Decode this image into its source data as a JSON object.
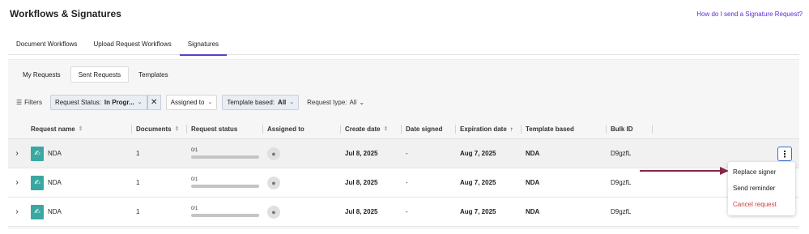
{
  "header": {
    "title": "Workflows & Signatures",
    "help_link": "How do I send a Signature Request?"
  },
  "main_tabs": [
    {
      "label": "Document Workflows"
    },
    {
      "label": "Upload Request Workflows"
    },
    {
      "label": "Signatures",
      "active": true
    }
  ],
  "sub_tabs": [
    {
      "label": "My Requests"
    },
    {
      "label": "Sent Requests",
      "active": true
    },
    {
      "label": "Templates"
    }
  ],
  "filters": {
    "label": "Filters",
    "request_status": {
      "name": "Request Status:",
      "value": "In Progr..."
    },
    "assigned_to": {
      "name": "Assigned to"
    },
    "template_based": {
      "name": "Template based:",
      "value": "All"
    },
    "request_type": {
      "name": "Request type:",
      "value": "All"
    }
  },
  "table": {
    "columns": [
      "Request name",
      "Documents",
      "Request status",
      "Assigned to",
      "Create date",
      "Date signed",
      "Expiration date",
      "Template based",
      "Bulk ID"
    ],
    "rows": [
      {
        "name": "NDA",
        "documents": "1",
        "status": "0/1",
        "progress": 0,
        "create_date": "Jul 8, 2025",
        "date_signed": "-",
        "expiration_date": "Aug 7, 2025",
        "template_based": "NDA",
        "bulk_id": "D9gzfL"
      },
      {
        "name": "NDA",
        "documents": "1",
        "status": "0/1",
        "progress": 0,
        "create_date": "Jul 8, 2025",
        "date_signed": "-",
        "expiration_date": "Aug 7, 2025",
        "template_based": "NDA",
        "bulk_id": "D9gzfL"
      },
      {
        "name": "NDA",
        "documents": "1",
        "status": "0/1",
        "progress": 0,
        "create_date": "Jul 8, 2025",
        "date_signed": "-",
        "expiration_date": "Aug 7, 2025",
        "template_based": "NDA",
        "bulk_id": "D9gzfL"
      }
    ]
  },
  "row_menu": {
    "items": [
      {
        "label": "Replace signer"
      },
      {
        "label": "Send reminder"
      },
      {
        "label": "Cancel request",
        "danger": true
      }
    ]
  },
  "colors": {
    "accent": "#5b3fd0",
    "link": "#5b2bd6",
    "doc_icon": "#3aa8a0",
    "danger": "#d23b3b",
    "arrow": "#8b2547"
  }
}
